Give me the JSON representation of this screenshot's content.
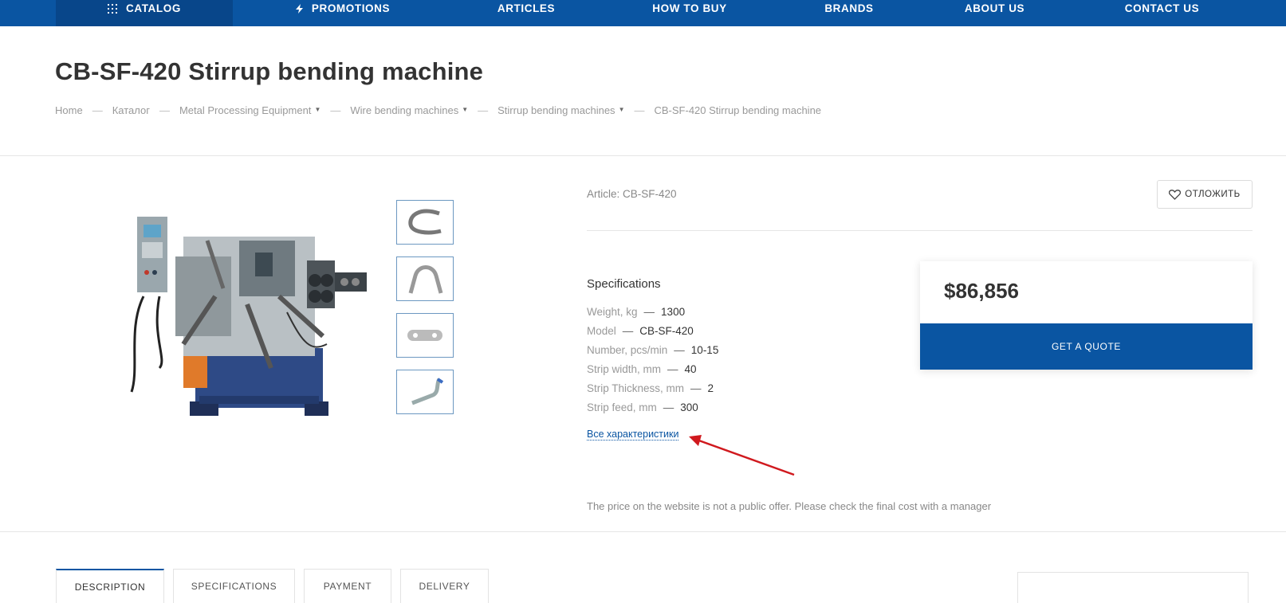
{
  "nav": {
    "catalog": "CATALOG",
    "promotions": "PROMOTIONS",
    "articles": "ARTICLES",
    "how_to_buy": "HOW TO BUY",
    "brands": "BRANDS",
    "about_us": "ABOUT US",
    "contact_us": "CONTACT US"
  },
  "page": {
    "title": "CB-SF-420 Stirrup bending machine"
  },
  "breadcrumb": [
    "Home",
    "Каталог",
    "Metal Processing Equipment",
    "Wire bending machines",
    "Stirrup bending machines",
    "CB-SF-420 Stirrup bending machine"
  ],
  "product": {
    "article": "Article: CB-SF-420",
    "save_label": "ОТЛОЖИТЬ",
    "spec_title": "Specifications",
    "specs": [
      {
        "k": "Weight, kg",
        "v": "1300"
      },
      {
        "k": "Model",
        "v": "CB-SF-420"
      },
      {
        "k": "Number, pcs/min",
        "v": "10-15"
      },
      {
        "k": "Strip width, mm",
        "v": "40"
      },
      {
        "k": "Strip Thickness, mm",
        "v": "2"
      },
      {
        "k": "Strip feed, mm",
        "v": "300"
      }
    ],
    "spec_dash": "—",
    "all_specs": "Все характеристики",
    "price": "$86,856",
    "quote_label": "GET A QUOTE",
    "disclaimer": "The price on the website is not a public offer. Please check the final cost with a manager"
  },
  "tabs": [
    "DESCRIPTION",
    "SPECIFICATIONS",
    "PAYMENT",
    "DELIVERY"
  ],
  "colors": {
    "brand_blue": "#0a55a2",
    "annotation_arrow": "#d0191e"
  },
  "icons": {
    "catalog": "grid-dots-icon",
    "promotions": "lightning-icon",
    "save": "heart-icon"
  }
}
